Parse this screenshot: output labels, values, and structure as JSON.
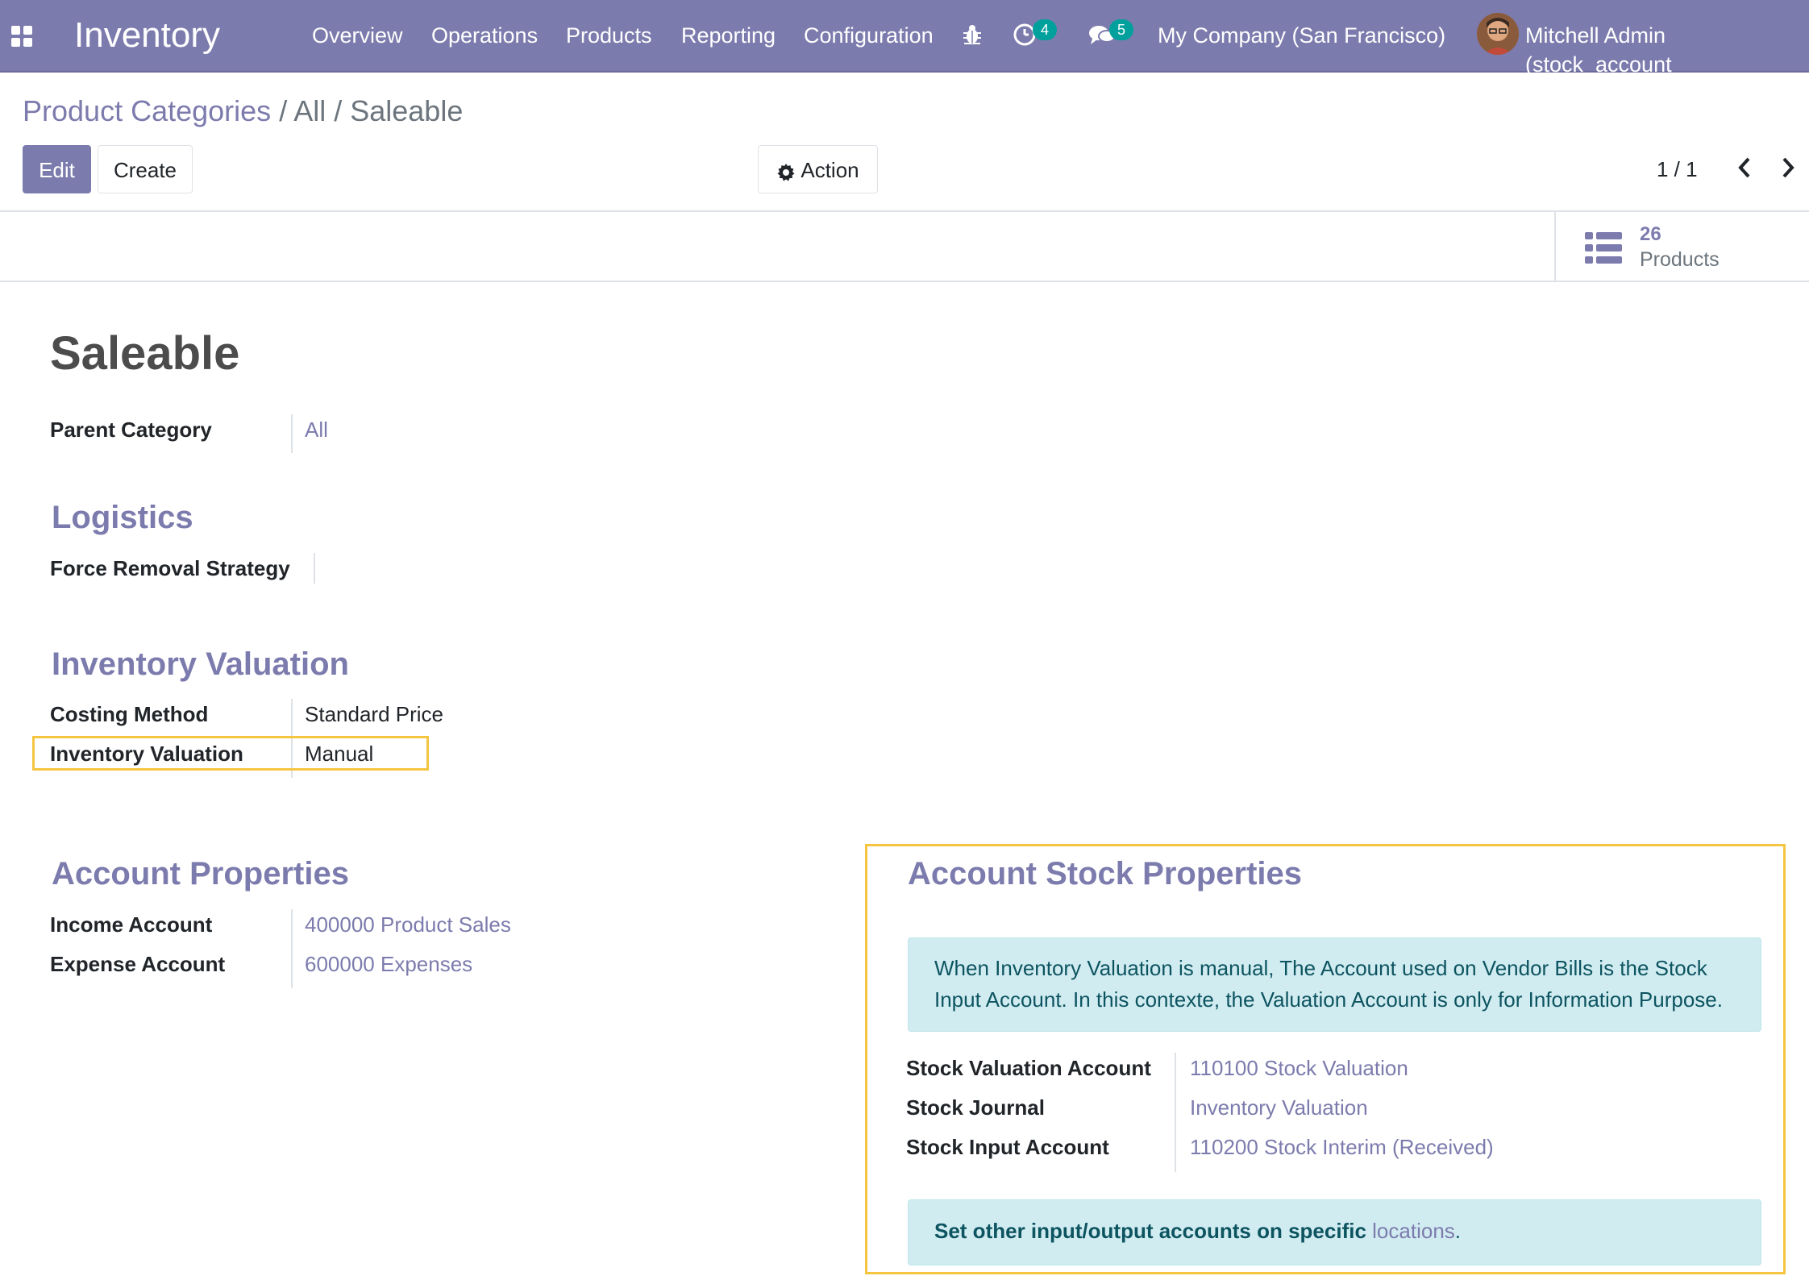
{
  "navbar": {
    "brand": "Inventory",
    "menu": [
      "Overview",
      "Operations",
      "Products",
      "Reporting",
      "Configuration"
    ],
    "activity_count": "4",
    "message_count": "5",
    "company": "My Company (San Francisco)",
    "user": "Mitchell Admin (stock_account",
    "icons": [
      "apps-icon",
      "bug-icon",
      "clock-icon",
      "chat-icon"
    ]
  },
  "breadcrumb": {
    "root": "Product Categories",
    "sep": "/",
    "current": "All / Saleable"
  },
  "toolbar": {
    "edit": "Edit",
    "create": "Create",
    "action": "Action",
    "pager": "1 / 1",
    "prev": "‹",
    "next": "›"
  },
  "smart_button": {
    "count": "26",
    "label": "Products"
  },
  "record": {
    "name": "Saleable",
    "parent_label": "Parent Category",
    "parent_value": "All"
  },
  "logistics": {
    "title": "Logistics",
    "removal_label": "Force Removal Strategy",
    "removal_value": ""
  },
  "valuation": {
    "title": "Inventory Valuation",
    "costing_label": "Costing Method",
    "costing_value": "Standard Price",
    "valuation_label": "Inventory Valuation",
    "valuation_value": "Manual"
  },
  "account_properties": {
    "title": "Account Properties",
    "income_label": "Income Account",
    "income_value": "400000 Product Sales",
    "expense_label": "Expense Account",
    "expense_value": "600000 Expenses"
  },
  "account_stock": {
    "title": "Account Stock Properties",
    "info_line1": "When Inventory Valuation is manual, The Account used on Vendor Bills is the Stock",
    "info_line2": "Input Account. In this contexte, the Valuation Account is only for Information Purpose.",
    "valuation_account_label": "Stock Valuation Account",
    "valuation_account_value": "110100 Stock Valuation",
    "journal_label": "Stock Journal",
    "journal_value": "Inventory Valuation",
    "input_label": "Stock Input Account",
    "input_value": "110200 Stock Interim (Received)",
    "footer_text": "Set other input/output accounts on specific",
    "footer_link": "locations",
    "footer_end": "."
  },
  "colors": {
    "brand": "#7c7bad",
    "badge": "#00a09d",
    "highlight": "#f5c542",
    "alert_bg": "#d1ecf1"
  }
}
